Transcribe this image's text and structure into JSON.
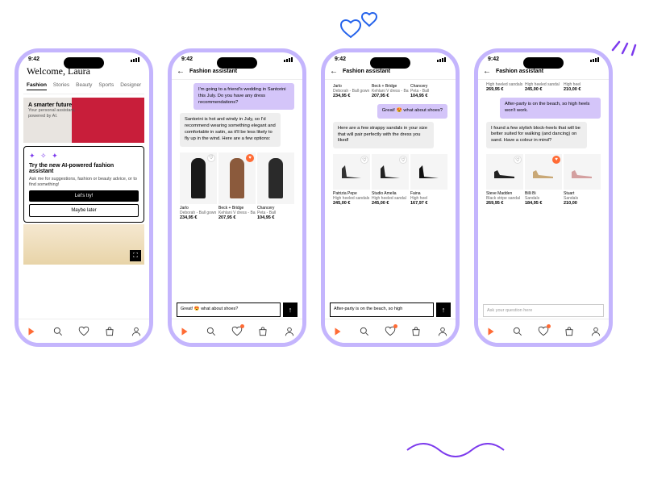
{
  "status_time": "9:42",
  "phone1": {
    "welcome": "Welcome, Laura",
    "tabs": [
      "Fashion",
      "Stories",
      "Beauty",
      "Sports",
      "Designer"
    ],
    "hero_title": "A smarter future",
    "hero_sub": "Your personal assistant, powered by AI.",
    "popup_title": "Try the new AI-powered fashion assistant",
    "popup_sub": "Ask me for suggestions, fashion or beauty advice, or to find something!",
    "btn_primary": "Let's try!",
    "btn_secondary": "Maybe later"
  },
  "assistant_title": "Fashion assistant",
  "phone2": {
    "user_msg": "I'm going to a friend's wedding in Santorini this July. Do you have any dress recommendations?",
    "ai_msg": "Santorini is hot and windy in July, so I'd recommend wearing something elegant and comfortable in satin, as it'll be less likely to fly up in the wind. Here are a few options:",
    "products": [
      {
        "brand": "Jarlo",
        "name": "Deborah - Ball gown",
        "price": "234,95 €",
        "fav": false,
        "color": "#1a1a1a"
      },
      {
        "brand": "Beck + Bridge",
        "name": "Kehlani V dress - Ball",
        "price": "207,95 €",
        "fav": true,
        "color": "#8b5a3c"
      },
      {
        "brand": "Chancery",
        "name": "Peta - Ball",
        "price": "104,95 €",
        "fav": false,
        "color": "#2a2a2a"
      }
    ],
    "input_value": "Great! 😍 what about shoes?"
  },
  "phone3": {
    "top_products": [
      {
        "brand": "Jarlo",
        "name": "Deborah - Ball gown",
        "price": "234,95 €"
      },
      {
        "brand": "Beck + Bridge",
        "name": "Kehlani V dress - Ball",
        "price": "207,95 €"
      },
      {
        "brand": "Chancery",
        "name": "Peta - Ball",
        "price": "104,95 €"
      }
    ],
    "user_msg": "Great! 😍 what about shoes?",
    "ai_msg": "Here are a few strappy sandals in your size that will pair perfectly with the dress you liked!",
    "products": [
      {
        "brand": "Patrizia Pepe",
        "name": "High heeled sandals",
        "price": "245,00 €",
        "fav": false
      },
      {
        "brand": "Studio Amelia",
        "name": "High heeled sandal",
        "price": "245,00 €",
        "fav": false
      },
      {
        "brand": "Faina",
        "name": "High heel",
        "price": "167,97 €",
        "fav": false
      }
    ],
    "input_value": "After-party is on the beach, so high"
  },
  "phone4": {
    "top_products": [
      {
        "name": "High heeled sandals",
        "price": "269,95 €"
      },
      {
        "name": "High heeled sandal",
        "price": "245,00 €"
      },
      {
        "name": "High heel",
        "price": "210,00 €"
      }
    ],
    "user_msg": "After-party is on the beach, so high heels won't work.",
    "ai_msg": "I found a few stylish block-heels that will be better suited for walking (and dancing) on sand. Have a colour in mind?",
    "products": [
      {
        "brand": "Steve Madden",
        "name": "Black stripe sandal",
        "price": "269,95 €",
        "fav": false
      },
      {
        "brand": "Billi Bi",
        "name": "Sandals",
        "price": "184,95 €",
        "fav": true
      },
      {
        "brand": "Stuart",
        "name": "Sandals",
        "price": "210,00",
        "fav": false
      }
    ],
    "input_placeholder": "Ask your question here"
  }
}
